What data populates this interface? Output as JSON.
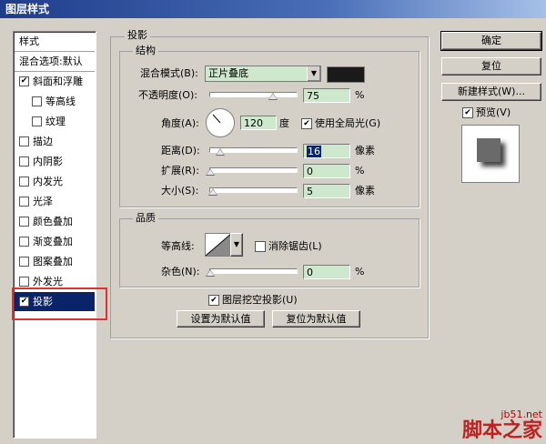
{
  "window": {
    "title": "图层样式"
  },
  "styles_list": {
    "header": "样式",
    "blend_options": "混合选项:默认",
    "items": [
      {
        "label": "斜面和浮雕",
        "checked": true
      },
      {
        "label": "等高线",
        "checked": false
      },
      {
        "label": "纹理",
        "checked": false
      },
      {
        "label": "描边",
        "checked": false
      },
      {
        "label": "内阴影",
        "checked": false
      },
      {
        "label": "内发光",
        "checked": false
      },
      {
        "label": "光泽",
        "checked": false
      },
      {
        "label": "颜色叠加",
        "checked": false
      },
      {
        "label": "渐变叠加",
        "checked": false
      },
      {
        "label": "图案叠加",
        "checked": false
      },
      {
        "label": "外发光",
        "checked": false
      },
      {
        "label": "投影",
        "checked": true
      }
    ]
  },
  "drop_shadow": {
    "section_title": "投影",
    "structure": {
      "title": "结构",
      "blend_mode_label": "混合模式(B):",
      "blend_mode_value": "正片叠底",
      "shadow_color": "#1a1a1a",
      "opacity_label": "不透明度(O):",
      "opacity_value": "75",
      "opacity_unit": "%",
      "angle_label": "角度(A):",
      "angle_value": "120",
      "angle_unit": "度",
      "global_light_label": "使用全局光(G)",
      "global_light_checked": true,
      "distance_label": "距离(D):",
      "distance_value": "16",
      "distance_unit": "像素",
      "spread_label": "扩展(R):",
      "spread_value": "0",
      "spread_unit": "%",
      "size_label": "大小(S):",
      "size_value": "5",
      "size_unit": "像素"
    },
    "quality": {
      "title": "品质",
      "contour_label": "等高线:",
      "antialias_label": "消除锯齿(L)",
      "antialias_checked": false,
      "noise_label": "杂色(N):",
      "noise_value": "0",
      "noise_unit": "%"
    },
    "knockout_label": "图层挖空投影(U)",
    "knockout_checked": true,
    "make_default_label": "设置为默认值",
    "reset_default_label": "复位为默认值"
  },
  "buttons": {
    "ok": "确定",
    "reset": "复位",
    "new_style": "新建样式(W)...",
    "preview_label": "预览(V)",
    "preview_checked": true
  },
  "watermark": {
    "site": "jb51.net",
    "brand": "脚本之家"
  }
}
